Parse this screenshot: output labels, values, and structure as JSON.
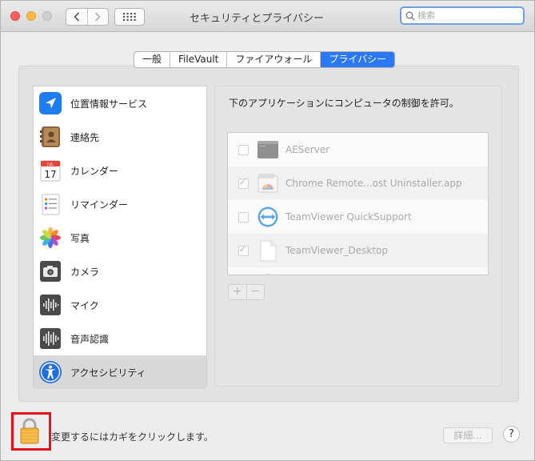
{
  "window": {
    "title": "セキュリティとプライバシー",
    "search_placeholder": "検索"
  },
  "tabs": [
    {
      "label": "一般",
      "active": false
    },
    {
      "label": "FileVault",
      "active": false
    },
    {
      "label": "ファイアウォール",
      "active": false
    },
    {
      "label": "プライバシー",
      "active": true
    }
  ],
  "sidebar": {
    "items": [
      {
        "label": "位置情報サービス",
        "icon": "location-icon"
      },
      {
        "label": "連絡先",
        "icon": "contacts-icon"
      },
      {
        "label": "カレンダー",
        "icon": "calendar-icon",
        "calendar_month": "JUL",
        "calendar_day": "17"
      },
      {
        "label": "リマインダー",
        "icon": "reminders-icon"
      },
      {
        "label": "写真",
        "icon": "photos-icon"
      },
      {
        "label": "カメラ",
        "icon": "camera-icon"
      },
      {
        "label": "マイク",
        "icon": "microphone-icon"
      },
      {
        "label": "音声認識",
        "icon": "speech-recognition-icon"
      },
      {
        "label": "アクセシビリティ",
        "icon": "accessibility-icon",
        "selected": true
      }
    ]
  },
  "panel": {
    "description": "下のアプリケーションにコンピュータの制御を許可。",
    "apps": [
      {
        "name": "AEServer",
        "checked": false,
        "icon": "terminal-app-icon"
      },
      {
        "name": "Chrome Remote...ost Uninstaller.app",
        "checked": true,
        "icon": "chrome-remote-icon"
      },
      {
        "name": "TeamViewer QuickSupport",
        "checked": false,
        "icon": "teamviewer-icon"
      },
      {
        "name": "TeamViewer_Desktop",
        "checked": true,
        "icon": "document-icon"
      }
    ],
    "add_label": "+",
    "remove_label": "−"
  },
  "footer": {
    "lock_text": "変更するにはカギをクリックします。",
    "detail_button": "詳細...",
    "help_button": "?"
  },
  "colors": {
    "accent": "#2a78f6",
    "highlight_box": "#e8101a"
  }
}
